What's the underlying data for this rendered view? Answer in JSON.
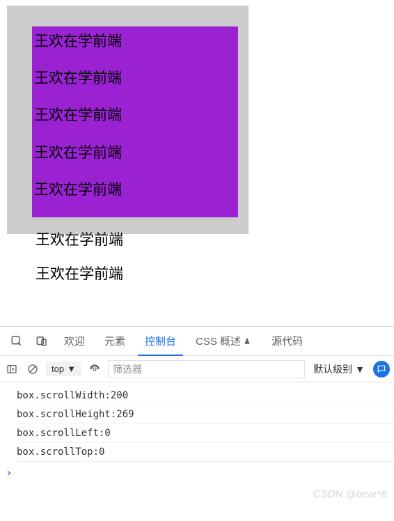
{
  "content": {
    "repeated_text": "王欢在学前端",
    "lines_inside": [
      "王欢在学前端",
      "王欢在学前端",
      "王欢在学前端",
      "王欢在学前端",
      "王欢在学前端"
    ],
    "overflow_lines": [
      "王欢在学前端",
      "王欢在学前端"
    ]
  },
  "devtools": {
    "tabs": {
      "welcome": "欢迎",
      "elements": "元素",
      "console": "控制台",
      "css_overview": "CSS 概述",
      "sources": "源代码"
    },
    "toolbar": {
      "context": "top",
      "filter_placeholder": "筛选器",
      "level": "默认级别"
    },
    "console_lines": [
      "box.scrollWidth:200",
      "box.scrollHeight:269",
      "box.scrollLeft:0",
      "box.scrollTop:0"
    ],
    "prompt": "›"
  },
  "watermark": "CSDN @bear*6"
}
